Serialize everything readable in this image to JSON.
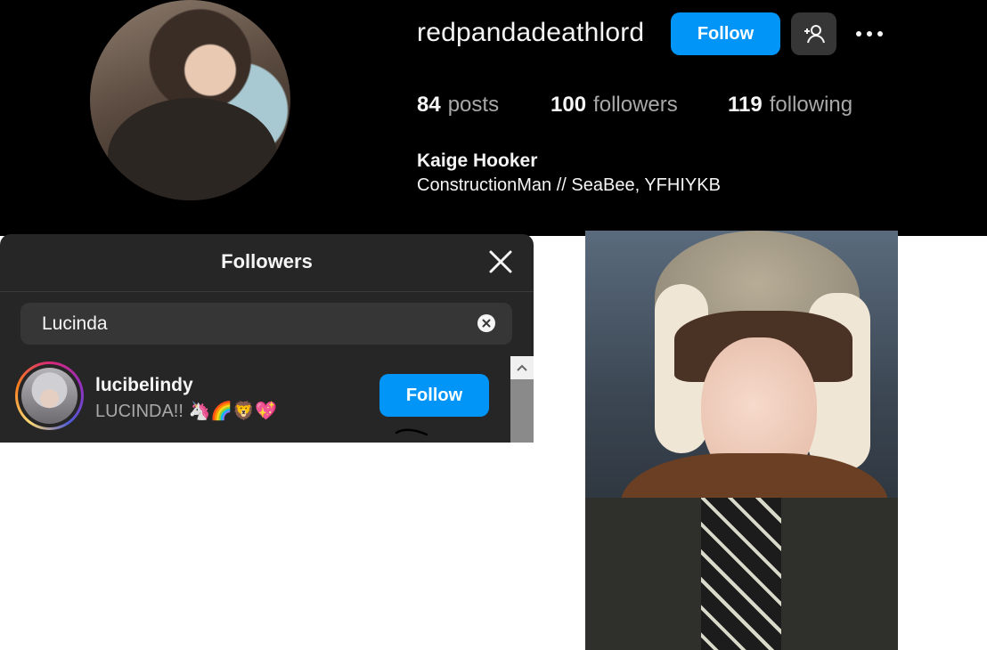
{
  "profile": {
    "username": "redpandadeathlord",
    "follow_label": "Follow",
    "stats": {
      "posts_count": "84",
      "posts_label": "posts",
      "followers_count": "100",
      "followers_label": "followers",
      "following_count": "119",
      "following_label": "following"
    },
    "full_name": "Kaige Hooker",
    "bio": "ConstructionMan // SeaBee, YFHIYKB"
  },
  "followers_modal": {
    "title": "Followers",
    "search": {
      "value": "Lucinda"
    },
    "results": [
      {
        "username": "lucibelindy",
        "subtitle": "LUCINDA!! 🦄🌈🦁💖",
        "follow_label": "Follow"
      }
    ]
  },
  "icons": {
    "close": "close-icon",
    "suggest": "add-person-icon",
    "more": "more-options-icon",
    "clear": "clear-search-icon"
  },
  "colors": {
    "accent": "#0095f6",
    "background_dark": "#000000",
    "modal_bg": "#262626"
  }
}
